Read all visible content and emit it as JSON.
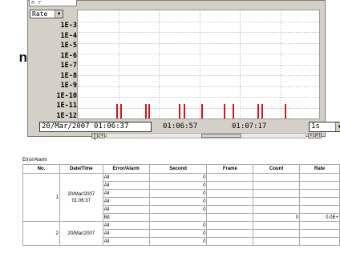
{
  "left_fragment": "n",
  "top_strip_text": "n r",
  "rate_selector": {
    "value": "Rate"
  },
  "y_axis_labels": [
    "1E-3",
    "1E-4",
    "1E-5",
    "1E-6",
    "1E-7",
    "1E-8",
    "1E-9",
    "1E-10",
    "1E-11",
    "1E-12"
  ],
  "time_bar": {
    "date_time": "20/Mar/2007  01:06:37",
    "tick2": "01:06:57",
    "tick3": "01:07:17",
    "resolution": "1s"
  },
  "scroll_buttons": {
    "first": "|◂",
    "prev": "◂",
    "next": "▸",
    "last": "▸|"
  },
  "error_table": {
    "title": "Error/Alarm",
    "headers": [
      "No.",
      "Date/Time",
      "Error/Alarm",
      "Second",
      "Frame",
      "Count",
      "Rate"
    ],
    "groups": [
      {
        "no": "1",
        "date": "20/Mar/2007",
        "time": "01:06:37",
        "rows": [
          {
            "alarm": "All",
            "second": "0",
            "frame": "",
            "count": "",
            "rate": ""
          },
          {
            "alarm": "All",
            "second": "0",
            "frame": "",
            "count": "",
            "rate": ""
          },
          {
            "alarm": "All",
            "second": "0",
            "frame": "",
            "count": "",
            "rate": ""
          },
          {
            "alarm": "All",
            "second": "0",
            "frame": "",
            "count": "",
            "rate": ""
          },
          {
            "alarm": "All",
            "second": "0",
            "frame": "",
            "count": "",
            "rate": ""
          },
          {
            "alarm": "Bit",
            "second": "",
            "frame": "",
            "count": "0",
            "rate": "0.0E+"
          }
        ]
      },
      {
        "no": "2",
        "date": "20/Mar/2007",
        "time": "",
        "rows": [
          {
            "alarm": "All",
            "second": "0",
            "frame": "",
            "count": "",
            "rate": ""
          },
          {
            "alarm": "All",
            "second": "0",
            "frame": "",
            "count": "",
            "rate": ""
          },
          {
            "alarm": "All",
            "second": "0",
            "frame": "",
            "count": "",
            "rate": ""
          }
        ]
      }
    ]
  },
  "colors": {
    "bar": "#d4151f",
    "panel": "#d4d0c8",
    "grid": "#c8c8c8"
  }
}
